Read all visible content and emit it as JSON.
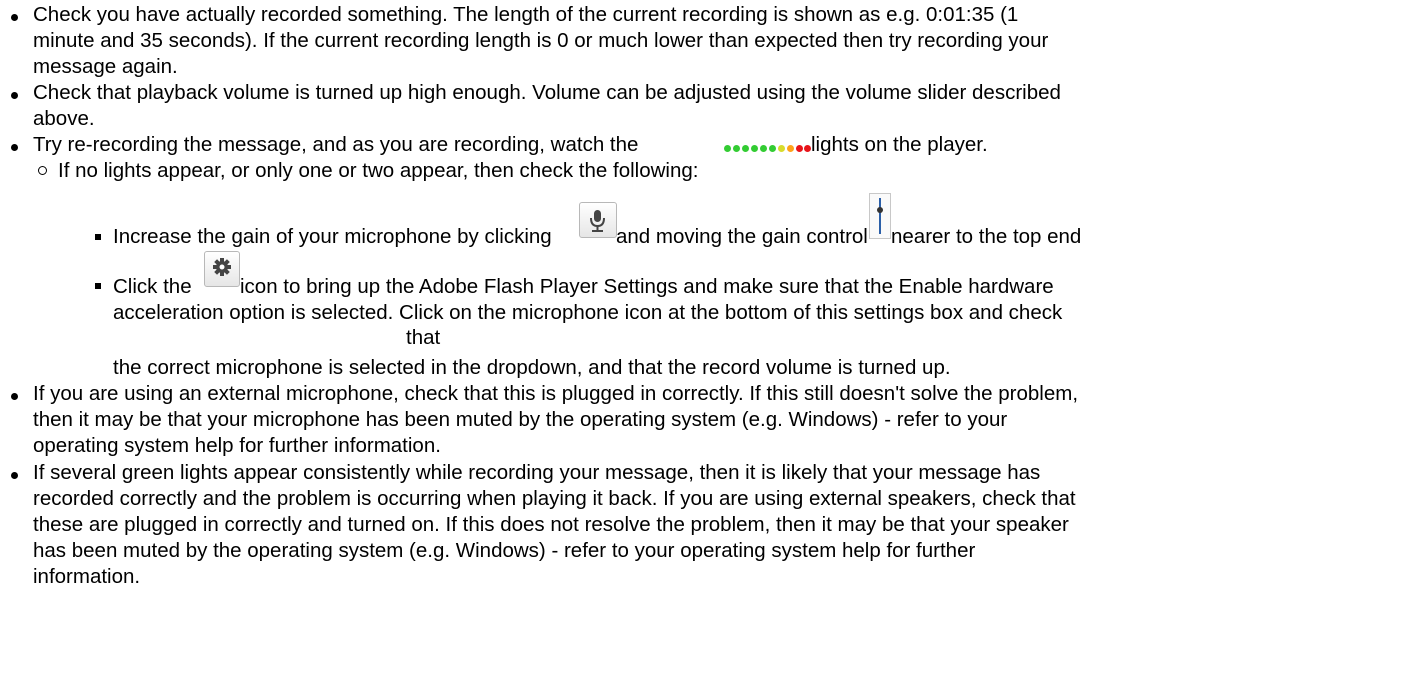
{
  "items": [
    {
      "lines": [
        "Check you have actually recorded something. The length of the current recording is shown as e.g. 0:01:35 (1",
        "minute and 35 seconds). If the current recording length is 0 or much lower than expected then try recording your",
        "message again."
      ]
    },
    {
      "lines": [
        "Check that playback volume is turned up high enough. Volume can be adjusted using the volume slider described",
        "above."
      ]
    },
    {
      "text_before": "Try re-recording the message, and as you are recording, watch the",
      "text_after": "lights on the player."
    }
  ],
  "sub_item": "If no lights appear, or only one or two appear, then check the following:",
  "sub_sub_items": [
    {
      "text_before": "Increase the gain of your microphone by clicking",
      "text_middle": "and moving the gain control",
      "text_after": "nearer to the top end"
    },
    {
      "text_before": "Click the",
      "text_after": "icon to bring up the Adobe Flash Player Settings and make sure that the Enable hardware",
      "lines": [
        "acceleration option is selected. Click on the microphone icon at the bottom of this settings box and check",
        "that",
        "the correct microphone is selected in the dropdown, and that the record volume is turned up."
      ]
    }
  ],
  "items_after": [
    {
      "lines": [
        "If you are using an external microphone, check that this is plugged in correctly. If this still doesn't solve the problem,",
        "then it may be that your microphone has been muted by the operating system (e.g. Windows) - refer to your",
        "operating system help for further information."
      ]
    },
    {
      "lines": [
        "If several green lights appear consistently while recording your message, then it is likely that your message has",
        "recorded correctly and the problem is occurring when playing it back. If you are using external speakers, check that",
        "these are plugged in correctly and turned on. If this does not resolve the problem, then it may be that your speaker",
        "has been muted by the operating system (e.g. Windows) - refer to your operating system help for further",
        "information."
      ]
    }
  ],
  "icons": {
    "microphone": "microphone-icon",
    "gain_control": "gain-slider-icon",
    "settings": "gear-icon",
    "level_lights": "level-lights-icon"
  },
  "colors": {
    "light_green": "#33cc33",
    "light_yellow": "#d8dc2c",
    "light_orange": "#ffa31a",
    "light_red": "#e8141a",
    "slider_blue": "#2b5fa8"
  }
}
